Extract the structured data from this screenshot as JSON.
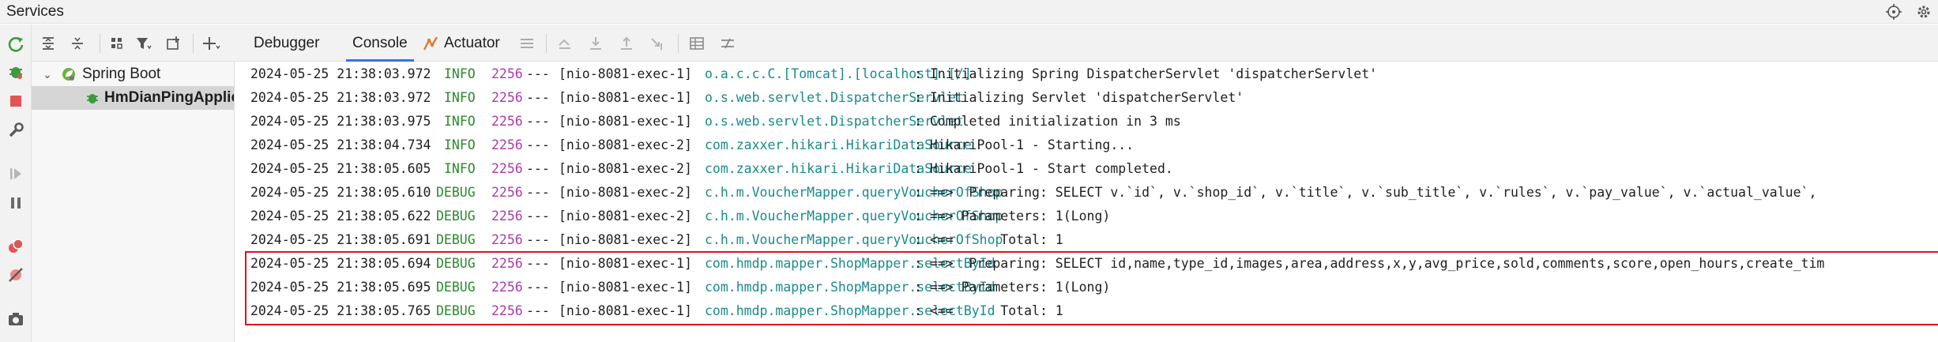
{
  "window": {
    "title": "Services"
  },
  "tree": {
    "items": [
      {
        "label": "Spring Boot",
        "expanded": true
      },
      {
        "label": "HmDianPingApplic"
      }
    ]
  },
  "tabs": [
    {
      "label": "Debugger"
    },
    {
      "label": "Console",
      "active": true
    },
    {
      "label": "Actuator"
    }
  ],
  "colors": {
    "accent": "#3574f0",
    "highlight_border": "#e0141e",
    "level": "#2a8a2a",
    "pid": "#a83aa8",
    "logger": "#1a8a8a",
    "stop": "#e05555",
    "run": "#3d9a3d"
  },
  "console": {
    "lines": [
      {
        "ts": "2024-05-25 21:38:03.972",
        "level": "INFO",
        "pid": "2256",
        "sep": "---",
        "thread": "[nio-8081-exec-1]",
        "logger": "o.a.c.c.C.[Tomcat].[localhost].[/]",
        "msg": ": Initializing Spring DispatcherServlet 'dispatcherServlet'"
      },
      {
        "ts": "2024-05-25 21:38:03.972",
        "level": "INFO",
        "pid": "2256",
        "sep": "---",
        "thread": "[nio-8081-exec-1]",
        "logger": "o.s.web.servlet.DispatcherServlet",
        "msg": ": Initializing Servlet 'dispatcherServlet'"
      },
      {
        "ts": "2024-05-25 21:38:03.975",
        "level": "INFO",
        "pid": "2256",
        "sep": "---",
        "thread": "[nio-8081-exec-1]",
        "logger": "o.s.web.servlet.DispatcherServlet",
        "msg": ": Completed initialization in 3 ms"
      },
      {
        "ts": "2024-05-25 21:38:04.734",
        "level": "INFO",
        "pid": "2256",
        "sep": "---",
        "thread": "[nio-8081-exec-2]",
        "logger": "com.zaxxer.hikari.HikariDataSource",
        "msg": ": HikariPool-1 - Starting..."
      },
      {
        "ts": "2024-05-25 21:38:05.605",
        "level": "INFO",
        "pid": "2256",
        "sep": "---",
        "thread": "[nio-8081-exec-2]",
        "logger": "com.zaxxer.hikari.HikariDataSource",
        "msg": ": HikariPool-1 - Start completed."
      },
      {
        "ts": "2024-05-25 21:38:05.610",
        "level": "DEBUG",
        "pid": "2256",
        "sep": "---",
        "thread": "[nio-8081-exec-2]",
        "logger": "c.h.m.VoucherMapper.queryVoucherOfShop",
        "msg": ": ==>  Preparing: SELECT v.`id`, v.`shop_id`, v.`title`, v.`sub_title`, v.`rules`, v.`pay_value`, v.`actual_value`,"
      },
      {
        "ts": "2024-05-25 21:38:05.622",
        "level": "DEBUG",
        "pid": "2256",
        "sep": "---",
        "thread": "[nio-8081-exec-2]",
        "logger": "c.h.m.VoucherMapper.queryVoucherOfShop",
        "msg": ": ==> Parameters: 1(Long)"
      },
      {
        "ts": "2024-05-25 21:38:05.691",
        "level": "DEBUG",
        "pid": "2256",
        "sep": "---",
        "thread": "[nio-8081-exec-2]",
        "logger": "c.h.m.VoucherMapper.queryVoucherOfShop",
        "msg": ": <==      Total: 1"
      },
      {
        "ts": "2024-05-25 21:38:05.694",
        "level": "DEBUG",
        "pid": "2256",
        "sep": "---",
        "thread": "[nio-8081-exec-1]",
        "logger": "com.hmdp.mapper.ShopMapper.selectById",
        "msg": ": ==>  Preparing: SELECT id,name,type_id,images,area,address,x,y,avg_price,sold,comments,score,open_hours,create_tim"
      },
      {
        "ts": "2024-05-25 21:38:05.695",
        "level": "DEBUG",
        "pid": "2256",
        "sep": "---",
        "thread": "[nio-8081-exec-1]",
        "logger": "com.hmdp.mapper.ShopMapper.selectById",
        "msg": ": ==> Parameters: 1(Long)"
      },
      {
        "ts": "2024-05-25 21:38:05.765",
        "level": "DEBUG",
        "pid": "2256",
        "sep": "---",
        "thread": "[nio-8081-exec-1]",
        "logger": "com.hmdp.mapper.ShopMapper.selectById",
        "msg": ": <==      Total: 1"
      }
    ]
  }
}
